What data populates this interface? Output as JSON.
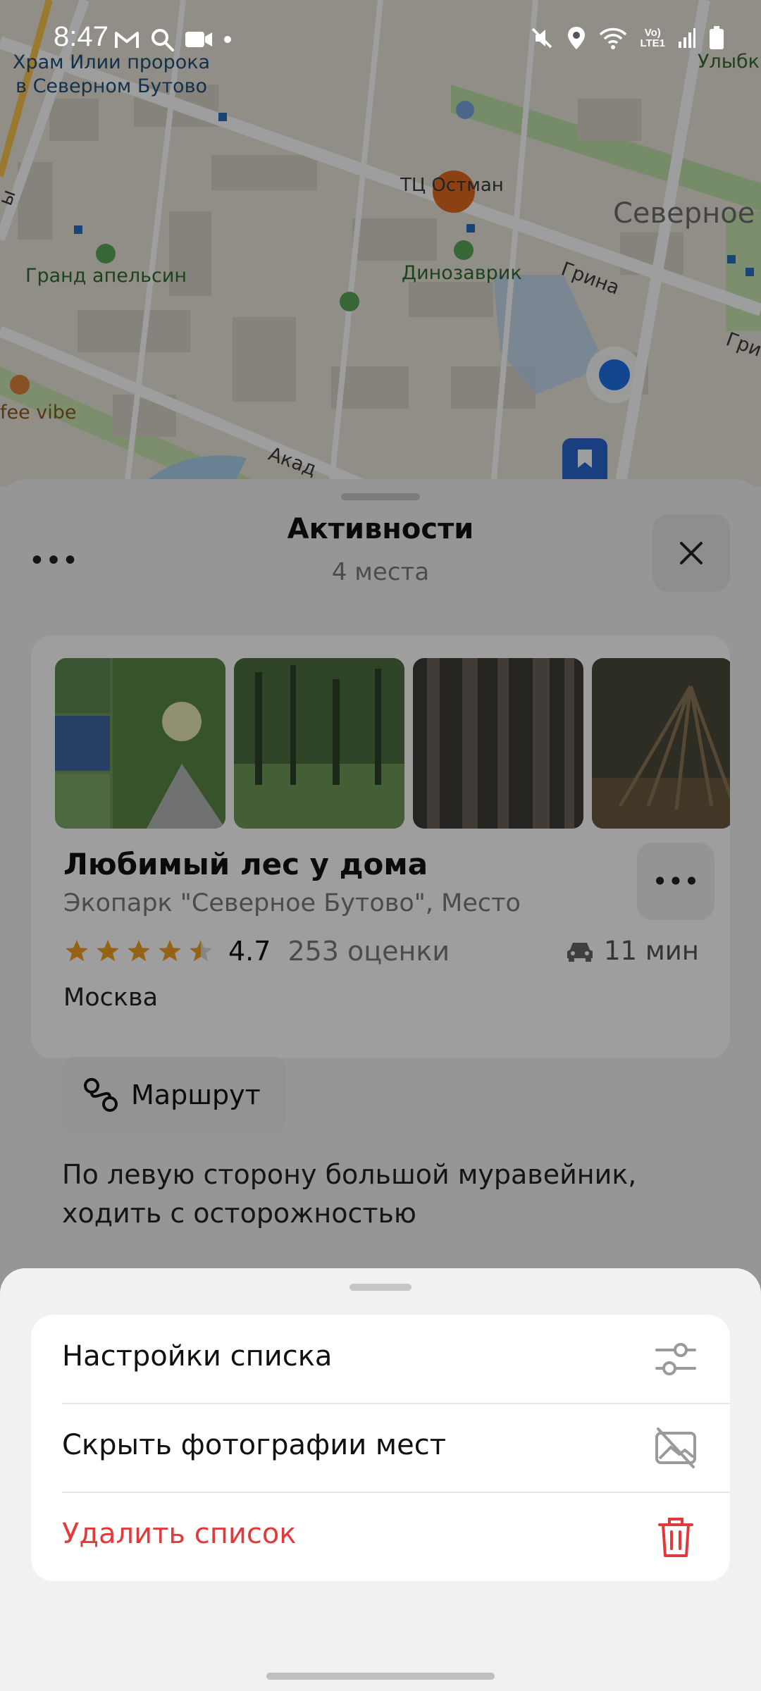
{
  "status_bar": {
    "time": "8:47",
    "network_label_top": "Vo)",
    "network_label_bottom": "LTE1",
    "icons": [
      "gmail-icon",
      "search-icon",
      "video-camera-icon",
      "dot-icon",
      "mute-icon",
      "location-icon",
      "wifi-icon",
      "signal-icon",
      "battery-icon"
    ]
  },
  "map": {
    "labels": {
      "church": "Храм Илии пророка\nв Северном Бутово",
      "grand": "Гранд апельсин",
      "dino": "Динозаврик",
      "tc": "ТЦ Остман",
      "street_grina": "Грина",
      "street_grina2": "Гри",
      "street_akad": "Акад",
      "severnoe": "Северное",
      "coffee": "fee vibe",
      "ulyb": "Улыбк",
      "left_edge": "ы"
    }
  },
  "panel": {
    "title": "Активности",
    "subtitle": "4 места",
    "card": {
      "title": "Любимый лес у дома",
      "subtitle": "Экопарк \"Северное Бутово\", Место",
      "rating": "4.7",
      "rating_count": "253 оценки",
      "travel_time": "11 мин",
      "city": "Москва",
      "route_label": "Маршрут",
      "note": "По левую сторону большой муравейник, ходить с осторожностью"
    }
  },
  "sheet": {
    "items": [
      {
        "label": "Настройки списка",
        "icon": "sliders-icon"
      },
      {
        "label": "Скрыть фотографии мест",
        "icon": "hide-photo-icon"
      },
      {
        "label": "Удалить список",
        "icon": "trash-icon"
      }
    ]
  },
  "colors": {
    "danger": "#e13a3a",
    "star": "#f0a020",
    "user_location": "#1e73e8"
  }
}
